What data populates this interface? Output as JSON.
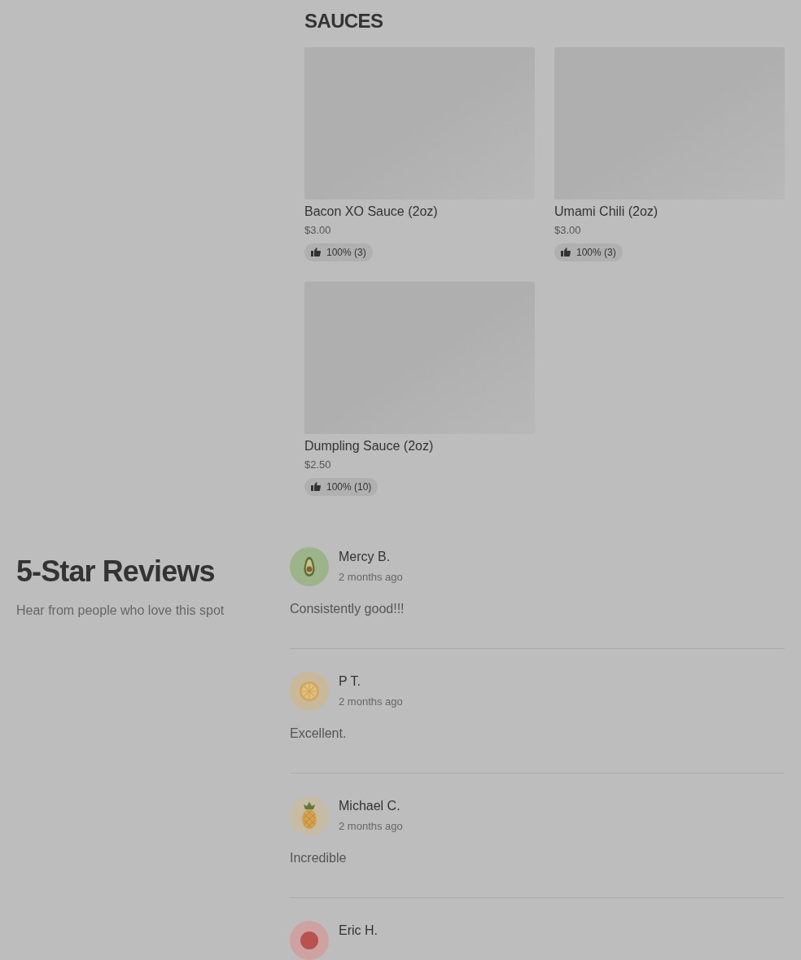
{
  "menu_section": {
    "title": "SAUCES",
    "items": [
      {
        "name": "Bacon XO Sauce (2oz)",
        "price": "$3.00",
        "rating": "100% (3)"
      },
      {
        "name": "Umami Chili (2oz)",
        "price": "$3.00",
        "rating": "100% (3)"
      },
      {
        "name": "Dumpling Sauce (2oz)",
        "price": "$2.50",
        "rating": "100% (10)"
      }
    ]
  },
  "reviews": {
    "title": "5-Star Reviews",
    "subtitle": "Hear from people who love this spot",
    "items": [
      {
        "name": "Mercy B.",
        "time": "2 months ago",
        "text": "Consistently good!!!",
        "kind": "avocado"
      },
      {
        "name": "P T.",
        "time": "2 months ago",
        "text": "Excellent.",
        "kind": "citrus"
      },
      {
        "name": "Michael C.",
        "time": "2 months ago",
        "text": "Incredible",
        "kind": "pineapple"
      },
      {
        "name": "Eric H.",
        "kind": "tomato"
      }
    ]
  }
}
